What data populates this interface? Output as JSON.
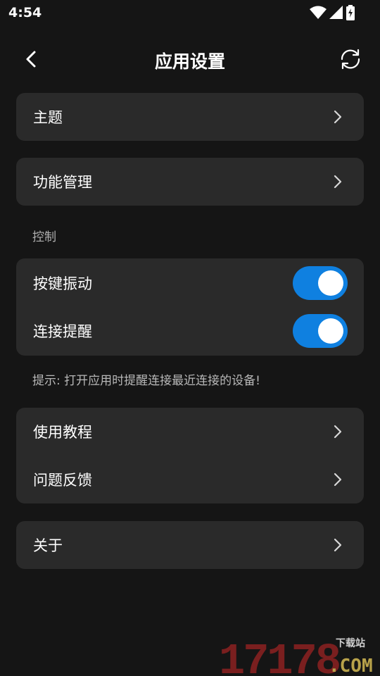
{
  "status_bar": {
    "time": "4:54",
    "icons": [
      "wifi-icon",
      "signal-icon",
      "battery-charging-icon"
    ]
  },
  "app_bar": {
    "title": "应用设置",
    "back_icon": "chevron-left-icon",
    "refresh_icon": "refresh-icon"
  },
  "menu": {
    "theme": "主题",
    "feature_management": "功能管理"
  },
  "control": {
    "section_label": "控制",
    "items": [
      {
        "label": "按键振动",
        "enabled": true
      },
      {
        "label": "连接提醒",
        "enabled": true
      }
    ],
    "hint": "提示: 打开应用时提醒连接最近连接的设备!"
  },
  "help": {
    "tutorial": "使用教程",
    "feedback": "问题反馈"
  },
  "about": "关于",
  "watermark": {
    "number": "17178",
    "site_tag": "下载站",
    "domain": ".COM"
  },
  "colors": {
    "background": "#151515",
    "card": "#2a2a2a",
    "toggle_on": "#0f80e0",
    "watermark_red": "#7a1f1f",
    "watermark_gold": "#b8a24a"
  }
}
